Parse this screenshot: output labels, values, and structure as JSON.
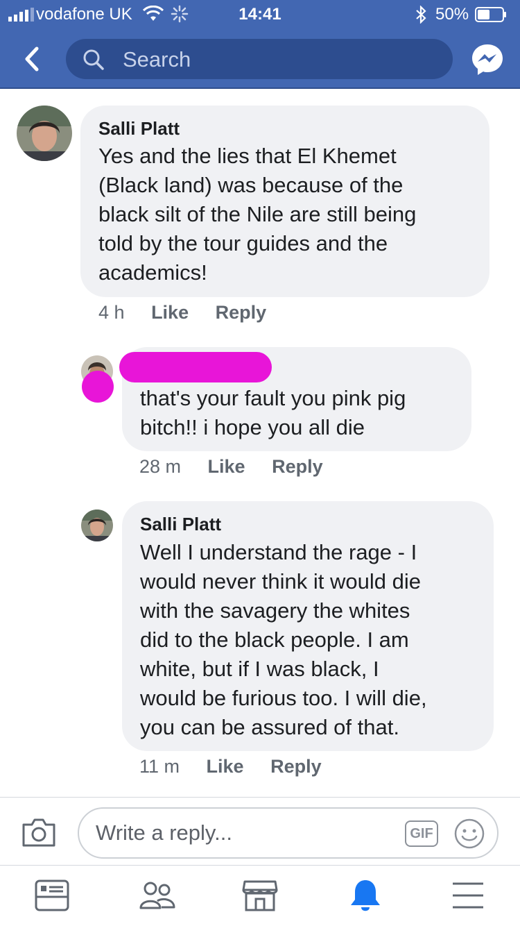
{
  "status_bar": {
    "carrier": "vodafone UK",
    "time": "14:41",
    "battery_percent": "50%",
    "battery_level": 0.5
  },
  "header": {
    "search_placeholder": "Search",
    "back_icon": "chevron-left-icon",
    "messenger_icon": "messenger-icon"
  },
  "comments": [
    {
      "author": "Salli Platt",
      "text": "Yes and the lies that El Khemet\n(Black land) was because of the\nblack silt of the Nile are still being\ntold by the tour guides and the\nacademics!",
      "time": "4 h",
      "like_label": "Like",
      "reply_label": "Reply"
    },
    {
      "author": "",
      "text": "that's your fault you pink pig\nbitch!! i hope you all die",
      "time": "28 m",
      "like_label": "Like",
      "reply_label": "Reply"
    },
    {
      "author": "Salli Platt",
      "text": "Well I understand the rage - I\nwould never think it would die\nwith the savagery the whites\ndid to the black people. I am\nwhite, but if I was black, I\nwould be furious too. I will die,\nyou can be assured of that.",
      "time": "11 m",
      "like_label": "Like",
      "reply_label": "Reply"
    }
  ],
  "reply_bar": {
    "placeholder": "Write a reply...",
    "gif_label": "GIF"
  },
  "tab_bar": {
    "tabs": [
      "news-feed-icon",
      "friends-icon",
      "marketplace-icon",
      "notifications-icon",
      "menu-icon"
    ],
    "active_tab": "notifications-icon"
  },
  "colors": {
    "header_blue": "#4267b2",
    "search_bg": "#2d4d8f",
    "bubble_bg": "#f0f1f4",
    "redaction": "#e815d8",
    "active_tab": "#1877f2"
  }
}
